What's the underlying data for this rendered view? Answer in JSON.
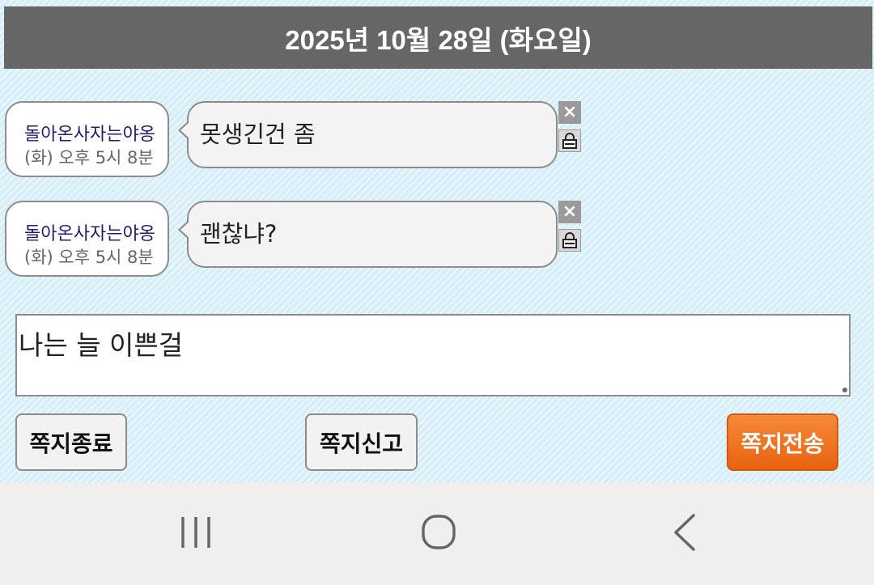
{
  "date_header": "2025년 10월 28일 (화요일)",
  "messages": [
    {
      "sender": "돌아온사자는야옹",
      "time": "(화) 오후 5시 8분",
      "text": "못생긴건 좀"
    },
    {
      "sender": "돌아온사자는야옹",
      "time": "(화) 오후 5시 8분",
      "text": "괜찮냐?"
    }
  ],
  "input": {
    "value": "나는 늘 이쁜걸"
  },
  "buttons": {
    "end": "쪽지종료",
    "report": "쪽지신고",
    "send": "쪽지전송"
  },
  "message_icons": {
    "delete": "close-icon",
    "lock": "lock-icon"
  },
  "nav": {
    "recents": "recents-icon",
    "home": "home-icon",
    "back": "back-icon"
  },
  "colors": {
    "header_bg": "#666666",
    "send_button": "#e8620f",
    "chat_background": "#d6eef8"
  }
}
